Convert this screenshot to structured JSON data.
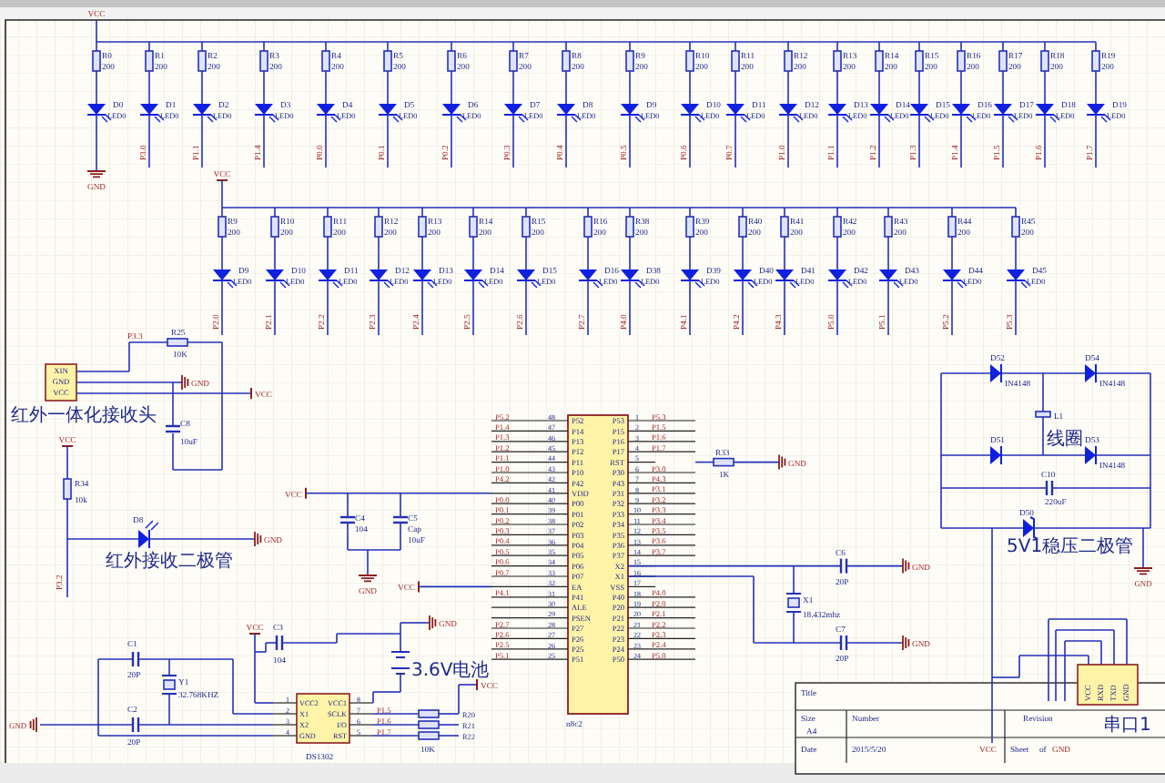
{
  "led_row_1": {
    "supply": "VCC",
    "ground": "GND",
    "columns": [
      {
        "resistor": "R0",
        "value": "200",
        "led": "D0",
        "led_value": "LED0"
      },
      {
        "resistor": "R1",
        "value": "200",
        "led": "D1",
        "led_value": "LED0",
        "net": "P3.0"
      },
      {
        "resistor": "R2",
        "value": "200",
        "led": "D2",
        "led_value": "LED0",
        "net": "P1.1"
      },
      {
        "resistor": "R3",
        "value": "200",
        "led": "D3",
        "led_value": "LED0",
        "net": "P1.4"
      },
      {
        "resistor": "R4",
        "value": "200",
        "led": "D4",
        "led_value": "LED0",
        "net": "P0.0"
      },
      {
        "resistor": "R5",
        "value": "200",
        "led": "D5",
        "led_value": "LED0",
        "net": "P0.1"
      },
      {
        "resistor": "R6",
        "value": "200",
        "led": "D6",
        "led_value": "LED0",
        "net": "P0.2"
      },
      {
        "resistor": "R7",
        "value": "200",
        "led": "D7",
        "led_value": "LED0",
        "net": "P0.3"
      },
      {
        "resistor": "R8",
        "value": "200",
        "led": "D8",
        "led_value": "LED0",
        "net": "P0.4"
      },
      {
        "resistor": "R9",
        "value": "200",
        "led": "D9",
        "led_value": "LED0",
        "net": "P0.5"
      },
      {
        "resistor": "R10",
        "value": "200",
        "led": "D10",
        "led_value": "LED0",
        "net": "P0.6"
      },
      {
        "resistor": "R11",
        "value": "200",
        "led": "D11",
        "led_value": "LED0",
        "net": "P0.7"
      },
      {
        "resistor": "R12",
        "value": "200",
        "led": "D12",
        "led_value": "LED0",
        "net": "P1.0"
      },
      {
        "resistor": "R13",
        "value": "200",
        "led": "D13",
        "led_value": "LED0",
        "net": "P1.1"
      },
      {
        "resistor": "R14",
        "value": "200",
        "led": "D14",
        "led_value": "LED0",
        "net": "P1.2"
      },
      {
        "resistor": "R15",
        "value": "200",
        "led": "D15",
        "led_value": "LED0",
        "net": "P1.3"
      },
      {
        "resistor": "R16",
        "value": "200",
        "led": "D16",
        "led_value": "LED0",
        "net": "P1.4"
      },
      {
        "resistor": "R17",
        "value": "200",
        "led": "D17",
        "led_value": "LED0",
        "net": "P1.5"
      },
      {
        "resistor": "R18",
        "value": "200",
        "led": "D18",
        "led_value": "LED0",
        "net": "P1.6"
      },
      {
        "resistor": "R19",
        "value": "200",
        "led": "D19",
        "led_value": "LED0",
        "net": "P1.7"
      }
    ]
  },
  "led_row_2": {
    "supply": "VCC",
    "columns": [
      {
        "resistor": "R9",
        "value": "200",
        "led": "D9",
        "led_value": "LED0",
        "net": "P2.0"
      },
      {
        "resistor": "R10",
        "value": "200",
        "led": "D10",
        "led_value": "LED0",
        "net": "P2.1"
      },
      {
        "resistor": "R11",
        "value": "200",
        "led": "D11",
        "led_value": "LED0",
        "net": "P2.2"
      },
      {
        "resistor": "R12",
        "value": "200",
        "led": "D12",
        "led_value": "LED0",
        "net": "P2.3"
      },
      {
        "resistor": "R13",
        "value": "200",
        "led": "D13",
        "led_value": "LED0",
        "net": "P2.4"
      },
      {
        "resistor": "R14",
        "value": "200",
        "led": "D14",
        "led_value": "LED0",
        "net": "P2.5"
      },
      {
        "resistor": "R15",
        "value": "200",
        "led": "D15",
        "led_value": "LED0",
        "net": "P2.6"
      },
      {
        "resistor": "R16",
        "value": "200",
        "led": "D16",
        "led_value": "LED0",
        "net": "P2.7"
      },
      {
        "resistor": "R38",
        "value": "200",
        "led": "D38",
        "led_value": "LED0",
        "net": "P4.0"
      },
      {
        "resistor": "R39",
        "value": "200",
        "led": "D39",
        "led_value": "LED0",
        "net": "P4.1"
      },
      {
        "resistor": "R40",
        "value": "200",
        "led": "D40",
        "led_value": "LED0",
        "net": "P4.2"
      },
      {
        "resistor": "R41",
        "value": "200",
        "led": "D41",
        "led_value": "LED0",
        "net": "P4.3"
      },
      {
        "resistor": "R42",
        "value": "200",
        "led": "D42",
        "led_value": "LED0",
        "net": "P5.0"
      },
      {
        "resistor": "R43",
        "value": "200",
        "led": "D43",
        "led_value": "LED0",
        "net": "P5.1"
      },
      {
        "resistor": "R44",
        "value": "200",
        "led": "D44",
        "led_value": "LED0",
        "net": "P5.2"
      },
      {
        "resistor": "R45",
        "value": "200",
        "led": "D45",
        "led_value": "LED0",
        "net": "P5.3"
      }
    ]
  },
  "ir_receiver": {
    "pins": [
      "XIN",
      "GND",
      "VCC"
    ],
    "caption": "红外一体化接收头",
    "net": "P3.3",
    "resistor": {
      "ref": "R25",
      "value": "10K"
    },
    "capacitor": {
      "ref": "C8",
      "value": "10uF"
    },
    "ground": "GND",
    "supply": "VCC"
  },
  "ir_led": {
    "supply": "VCC",
    "resistor": {
      "ref": "R34",
      "value": "10k"
    },
    "led": "D8",
    "caption": "红外接收二极管",
    "ground": "GND",
    "net": "P3.2"
  },
  "decoupling": {
    "supply": "VCC",
    "capacitors": [
      {
        "ref": "C4",
        "values": [
          "104"
        ]
      },
      {
        "ref": "C5",
        "values": [
          "Cap",
          "10uF"
        ]
      }
    ],
    "ground": "GND",
    "ea_supply": "VCC"
  },
  "rtc": {
    "chip": "DS1302",
    "pins_left": [
      {
        "num": "1",
        "name": "VCC2"
      },
      {
        "num": "2",
        "name": "X1"
      },
      {
        "num": "3",
        "name": "X2"
      },
      {
        "num": "4",
        "name": "GND"
      }
    ],
    "pins_right": [
      {
        "num": "8",
        "name": "VCC1"
      },
      {
        "num": "7",
        "name": "SCLK",
        "net": "P1.5",
        "resistor": "R20"
      },
      {
        "num": "6",
        "name": "I/O",
        "net": "P1.6",
        "resistor": "R21"
      },
      {
        "num": "5",
        "name": "RST",
        "net": "P1.7",
        "resistor": "R22"
      }
    ],
    "resistor_value": "10K",
    "capacitors": [
      {
        "ref": "C1",
        "value": "20P"
      },
      {
        "ref": "C2",
        "value": "20P"
      },
      {
        "ref": "C3",
        "value": "104"
      }
    ],
    "crystal": {
      "ref": "Y1",
      "value": "32.768KHZ"
    },
    "supply": "VCC",
    "ground_left": "GND",
    "ground_right": "GND",
    "battery": "3.6V电池",
    "pullup_supply": "VCC"
  },
  "mcu": {
    "name": "n8c2",
    "left_pins": [
      {
        "num": "48",
        "name": "P52",
        "net": "P5.2"
      },
      {
        "num": "47",
        "name": "P14",
        "net": "P1.4"
      },
      {
        "num": "46",
        "name": "P13",
        "net": "P1.3"
      },
      {
        "num": "45",
        "name": "P12",
        "net": "P1.2"
      },
      {
        "num": "44",
        "name": "P11",
        "net": "P1.1"
      },
      {
        "num": "43",
        "name": "P10",
        "net": "P1.0"
      },
      {
        "num": "42",
        "name": "P42",
        "net": "P4.2"
      },
      {
        "num": "41",
        "name": "VDD"
      },
      {
        "num": "40",
        "name": "P00",
        "net": "P0.0"
      },
      {
        "num": "39",
        "name": "P01",
        "net": "P0.1"
      },
      {
        "num": "38",
        "name": "P02",
        "net": "P0.2"
      },
      {
        "num": "37",
        "name": "P03",
        "net": "P0.3"
      },
      {
        "num": "36",
        "name": "P04",
        "net": "P0.4"
      },
      {
        "num": "35",
        "name": "P05",
        "net": "P0.5"
      },
      {
        "num": "34",
        "name": "P06",
        "net": "P0.6"
      },
      {
        "num": "33",
        "name": "P07",
        "net": "P0.7"
      },
      {
        "num": "32",
        "name": "EA"
      },
      {
        "num": "31",
        "name": "P41",
        "net": "P4.1"
      },
      {
        "num": "30",
        "name": "ALE"
      },
      {
        "num": "29",
        "name": "PSEN"
      },
      {
        "num": "28",
        "name": "P27",
        "net": "P2.7"
      },
      {
        "num": "27",
        "name": "P26",
        "net": "P2.6"
      },
      {
        "num": "26",
        "name": "P25",
        "net": "P2.5"
      },
      {
        "num": "25",
        "name": "P51",
        "net": "P5.1"
      }
    ],
    "right_pins": [
      {
        "num": "1",
        "name": "P53",
        "net": "P5.3"
      },
      {
        "num": "2",
        "name": "P15",
        "net": "P1.5"
      },
      {
        "num": "3",
        "name": "P16",
        "net": "P1.6"
      },
      {
        "num": "4",
        "name": "P17",
        "net": "P1.7"
      },
      {
        "num": "5",
        "name": "RST"
      },
      {
        "num": "6",
        "name": "P30",
        "net": "P3.0"
      },
      {
        "num": "7",
        "name": "P43",
        "net": "P4.3"
      },
      {
        "num": "8",
        "name": "P31",
        "net": "P3.1"
      },
      {
        "num": "9",
        "name": "P32",
        "net": "P3.2"
      },
      {
        "num": "10",
        "name": "P33",
        "net": "P3.3"
      },
      {
        "num": "11",
        "name": "P34",
        "net": "P3.4"
      },
      {
        "num": "12",
        "name": "P35",
        "net": "P3.5"
      },
      {
        "num": "13",
        "name": "P36",
        "net": "P3.6"
      },
      {
        "num": "14",
        "name": "P37",
        "net": "P3.7"
      },
      {
        "num": "15",
        "name": "X2"
      },
      {
        "num": "16",
        "name": "X1"
      },
      {
        "num": "17",
        "name": "VSS"
      },
      {
        "num": "18",
        "name": "P40",
        "net": "P4.0"
      },
      {
        "num": "19",
        "name": "P20",
        "net": "P2.0"
      },
      {
        "num": "20",
        "name": "P21",
        "net": "P2.1"
      },
      {
        "num": "21",
        "name": "P22",
        "net": "P2.2"
      },
      {
        "num": "22",
        "name": "P23",
        "net": "P2.3"
      },
      {
        "num": "23",
        "name": "P24",
        "net": "P2.4"
      },
      {
        "num": "24",
        "name": "P50",
        "net": "P5.0"
      }
    ]
  },
  "reset": {
    "resistor": {
      "ref": "R33",
      "value": "1K"
    },
    "ground": "GND"
  },
  "oscillator": {
    "capacitors": [
      {
        "ref": "C6",
        "value": "20P",
        "ground": "GND"
      },
      {
        "ref": "C7",
        "value": "20P",
        "ground": "GND"
      }
    ],
    "crystal": {
      "ref": "X1",
      "value": "18.432mhz"
    }
  },
  "power": {
    "diodes": [
      {
        "ref": "D52",
        "value": "IN4148"
      },
      {
        "ref": "D54",
        "value": "IN4148"
      },
      {
        "ref": "D51"
      },
      {
        "ref": "D53",
        "value": "IN4148"
      }
    ],
    "coil": {
      "ref": "L1",
      "caption": "线圈"
    },
    "capacitor": {
      "ref": "C10",
      "value": "220uF"
    },
    "zener": {
      "ref": "D50",
      "caption": "5V1稳压二极管"
    },
    "ground": "GND"
  },
  "serial_port": {
    "pins": [
      "VCC",
      "RXD",
      "TXD",
      "GND"
    ],
    "caption": "串口1"
  },
  "title_block": {
    "title_label": "Title",
    "size_label": "Size",
    "size": "A4",
    "number_label": "Number",
    "revision_label": "Revision",
    "date_label": "Date",
    "date": "2015/5/20",
    "sheet_label": "Sheet",
    "of_label": "of",
    "supply": "VCC",
    "ground": "GND"
  }
}
